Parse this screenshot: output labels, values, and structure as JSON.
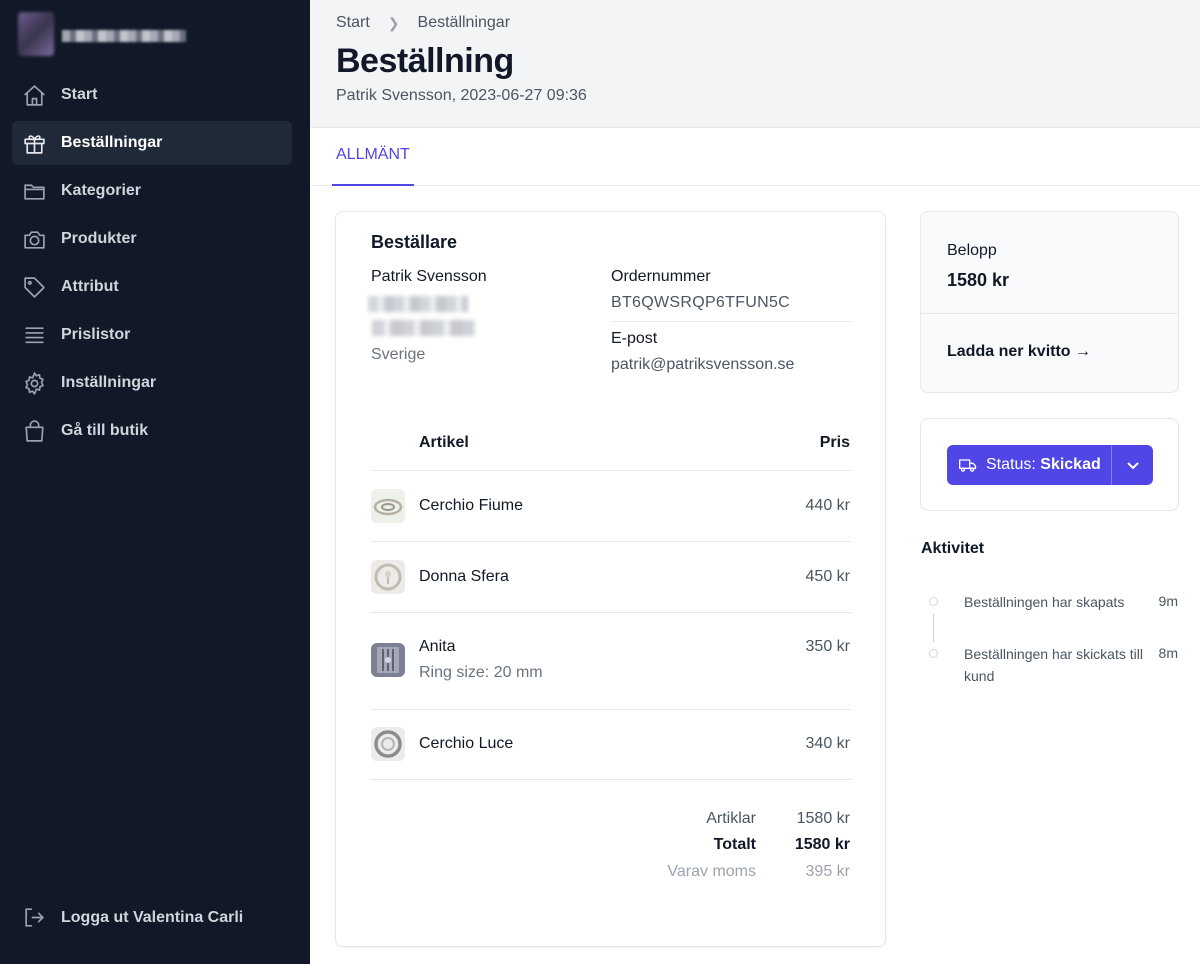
{
  "sidebar": {
    "brand_name": "",
    "items": [
      {
        "label": "Start",
        "icon": "home-icon"
      },
      {
        "label": "Beställningar",
        "icon": "gift-icon"
      },
      {
        "label": "Kategorier",
        "icon": "folder-icon"
      },
      {
        "label": "Produkter",
        "icon": "camera-icon"
      },
      {
        "label": "Attribut",
        "icon": "tag-icon"
      },
      {
        "label": "Prislistor",
        "icon": "list-icon"
      },
      {
        "label": "Inställningar",
        "icon": "gear-icon"
      },
      {
        "label": "Gå till butik",
        "icon": "shopping-bag-icon"
      }
    ],
    "active_index": 1,
    "logout_label": "Logga ut Valentina Carli"
  },
  "header": {
    "breadcrumb": [
      "Start",
      "Beställningar"
    ],
    "title": "Beställning",
    "subtitle": "Patrik Svensson, 2023-06-27 09:36"
  },
  "tabs": [
    {
      "label": "ALLMÄNT",
      "active": true
    }
  ],
  "order": {
    "section_title": "Beställare",
    "customer_name": "Patrik Svensson",
    "country": "Sverige",
    "order_number_label": "Ordernummer",
    "order_number": "BT6QWSRQP6TFUN5C",
    "email_label": "E-post",
    "email": "patrik@patriksvensson.se",
    "table_headers": {
      "article": "Artikel",
      "price": "Pris"
    },
    "items": [
      {
        "name": "Cerchio Fiume",
        "sub": "",
        "price": "440 kr"
      },
      {
        "name": "Donna Sfera",
        "sub": "",
        "price": "450 kr"
      },
      {
        "name": "Anita",
        "sub": "Ring size: 20 mm",
        "price": "350 kr"
      },
      {
        "name": "Cerchio Luce",
        "sub": "",
        "price": "340 kr"
      }
    ],
    "totals": [
      {
        "label": "Artiklar",
        "value": "1580 kr"
      },
      {
        "label": "Totalt",
        "value": "1580 kr"
      },
      {
        "label": "Varav moms",
        "value": "395 kr"
      }
    ]
  },
  "summary": {
    "amount_label": "Belopp",
    "amount": "1580 kr",
    "download_label": "Ladda ner kvitto →"
  },
  "status": {
    "prefix": "Status:",
    "value": "Skickad",
    "accent": "#4f46e5"
  },
  "activity": {
    "title": "Aktivitet",
    "events": [
      {
        "text": "Beställningen har skapats",
        "time": "9m"
      },
      {
        "text": "Beställningen har skickats till kund",
        "time": "8m"
      }
    ]
  }
}
